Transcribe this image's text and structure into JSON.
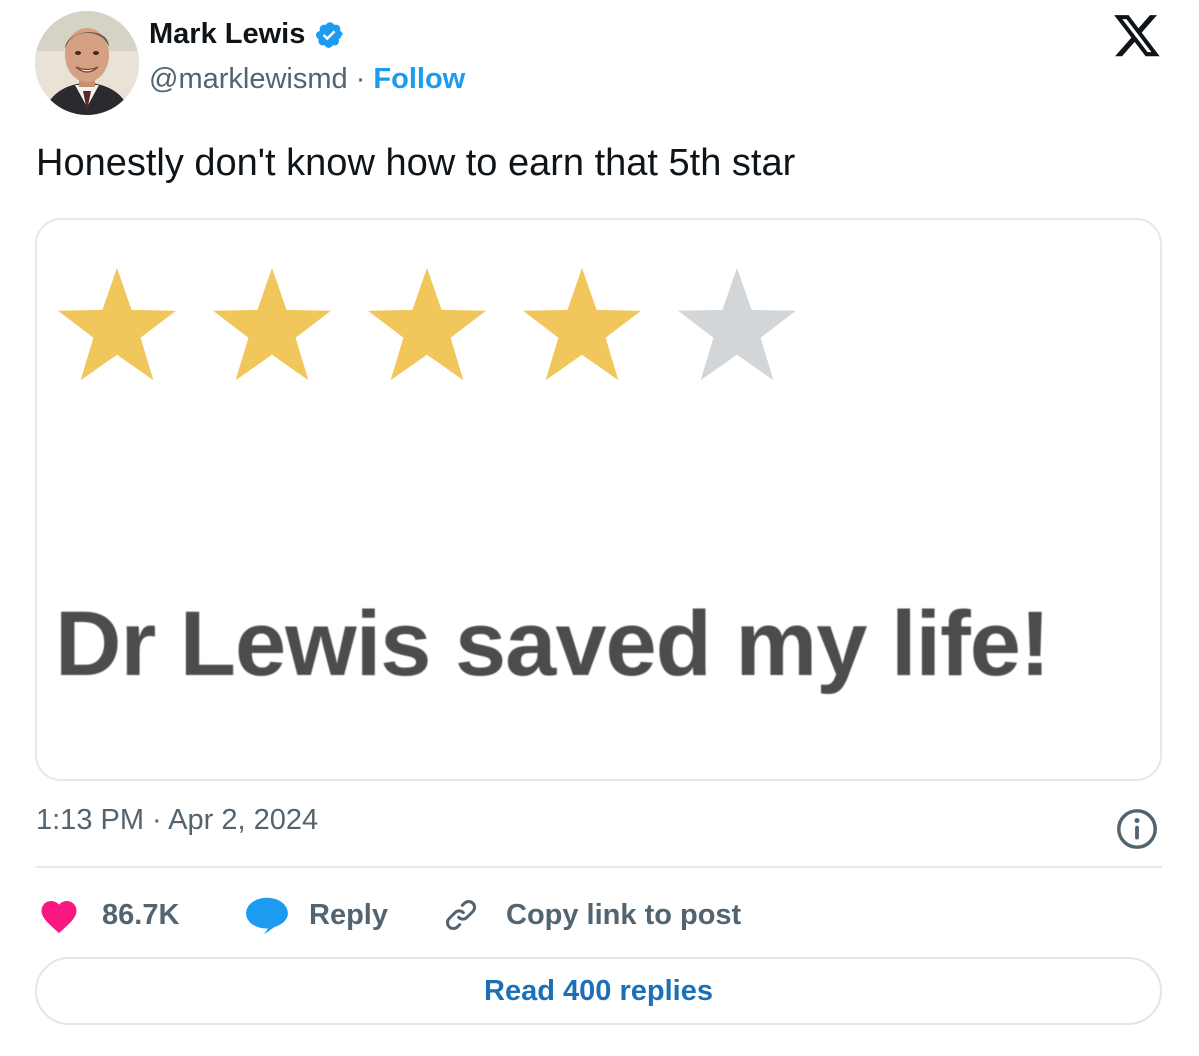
{
  "author": {
    "name": "Mark Lewis",
    "handle": "@marklewismd",
    "separator": "·",
    "follow_label": "Follow",
    "verified": true
  },
  "tweet": {
    "text": "Honestly don't know how to earn that 5th star",
    "timestamp": "1:13 PM · Apr 2, 2024"
  },
  "media": {
    "rating": {
      "filled": 4,
      "total": 5
    },
    "star_color": "#f1c75b",
    "empty_star_color": "#d3d6d8",
    "review_text": "Dr Lewis saved my life!"
  },
  "actions": {
    "like_count": "86.7K",
    "reply_label": "Reply",
    "copy_link_label": "Copy link to post"
  },
  "read_replies_label": "Read 400 replies",
  "colors": {
    "accent": "#1d9bf0",
    "like": "#f91880",
    "muted": "#536471"
  },
  "icons": [
    "verified-badge-icon",
    "x-logo-icon",
    "info-icon",
    "heart-icon",
    "speech-bubble-icon",
    "link-icon",
    "star-icon"
  ]
}
